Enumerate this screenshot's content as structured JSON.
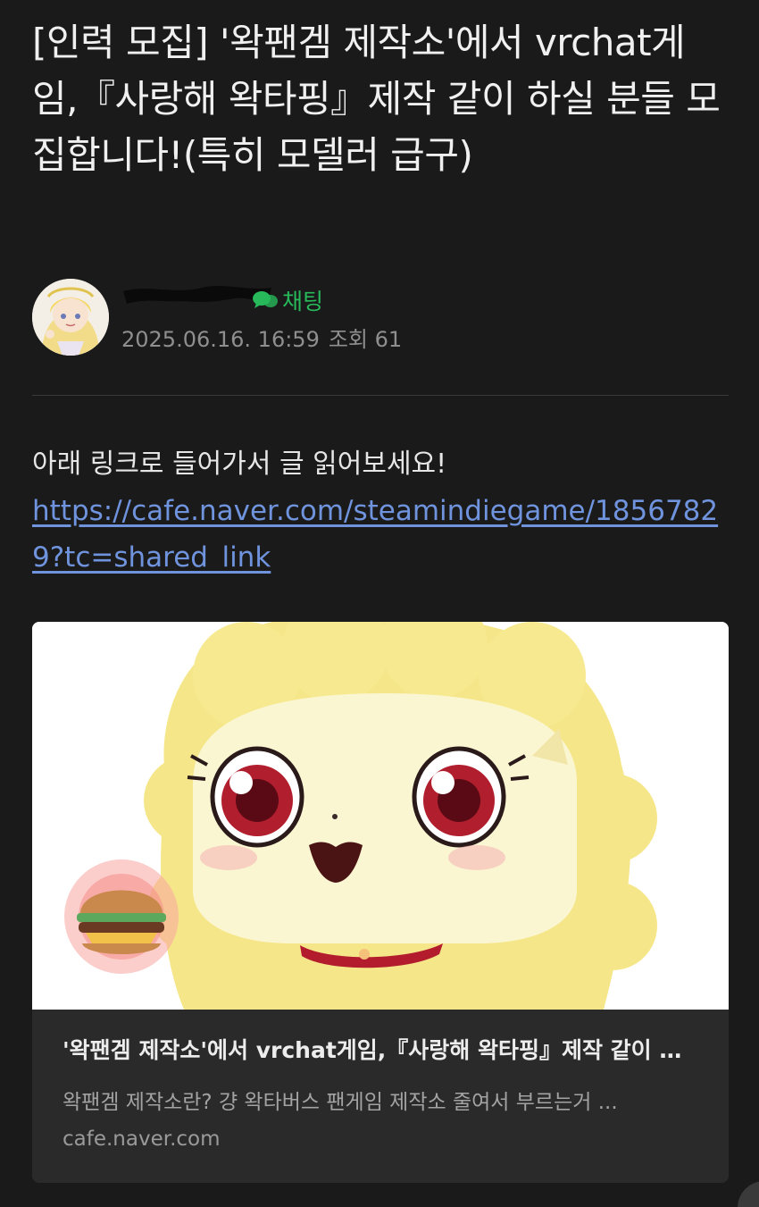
{
  "post": {
    "title": "[인력 모집] '왁팬겜 제작소'에서 vrchat게임,『사랑해 왁타핑』제작 같이 하실 분들 모집합니다!(특히 모델러 급구)",
    "chat_label": "채팅",
    "date": "2025.06.16. 16:59",
    "views_label": "조회 61",
    "body_text": "아래 링크로 들어가서 글 읽어보세요!",
    "body_link": "https://cafe.naver.com/steamindiegame/18567829?tc=shared_link"
  },
  "link_card": {
    "title": "'왁팬겜 제작소'에서 vrchat게임,『사랑해 왁타핑』제작 같이 하실 분들 모집합니다!",
    "description": "왁팬겜 제작소란? 걍 왁타버스 팬게임 제작소 줄여서 부르는거 ...",
    "domain": "cafe.naver.com"
  },
  "icons": {
    "chat": "chat-bubbles-icon",
    "avatar": "user-avatar",
    "card_image": "character-illustration"
  },
  "colors": {
    "background": "#1a1a1a",
    "chat_green": "#27b95a",
    "link_blue": "#6f93dd",
    "card_bg": "#2a2a2a"
  }
}
